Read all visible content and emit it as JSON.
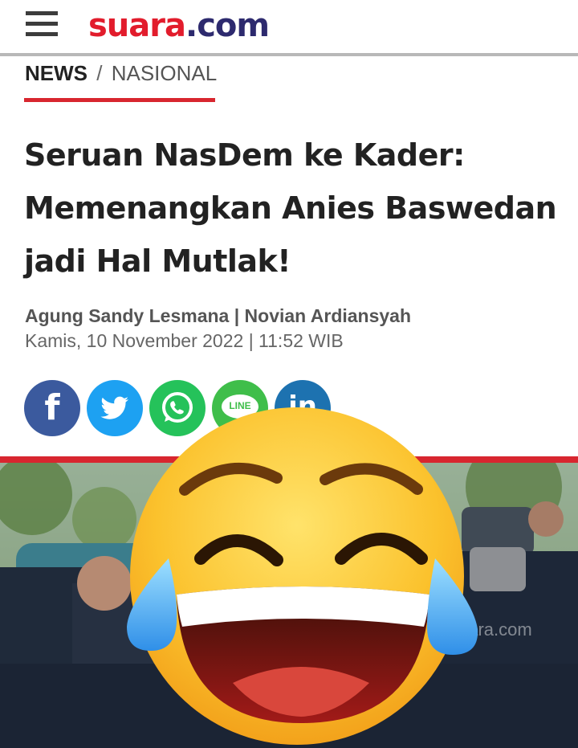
{
  "header": {
    "logo_brand": "suara",
    "logo_tld": ".com",
    "menu_icon": "hamburger-menu-icon"
  },
  "breadcrumb": {
    "root": "NEWS",
    "separator": "/",
    "section": "NASIONAL"
  },
  "article": {
    "title": "Seruan NasDem ke Kader: Memenangkan Anies Baswedan jadi Hal Mutlak!",
    "authors": "Agung Sandy Lesmana | Novian Ardiansyah",
    "date": "Kamis, 10 November 2022 | 11:52 WIB"
  },
  "share": {
    "facebook_glyph": "f",
    "line_label": "LINE",
    "linkedin_glyph": "in",
    "icons": [
      "facebook-icon",
      "twitter-icon",
      "whatsapp-icon",
      "line-icon",
      "linkedin-icon"
    ]
  },
  "photo": {
    "watermark": "suara.com"
  },
  "colors": {
    "brand_red": "#e21c2c",
    "brand_navy": "#2d2a6e",
    "accent_red": "#d8262f",
    "facebook": "#3b5a9e",
    "twitter": "#1da1f2",
    "whatsapp": "#25c25a",
    "line": "#3fbe4a",
    "linkedin": "#1d72b0"
  }
}
